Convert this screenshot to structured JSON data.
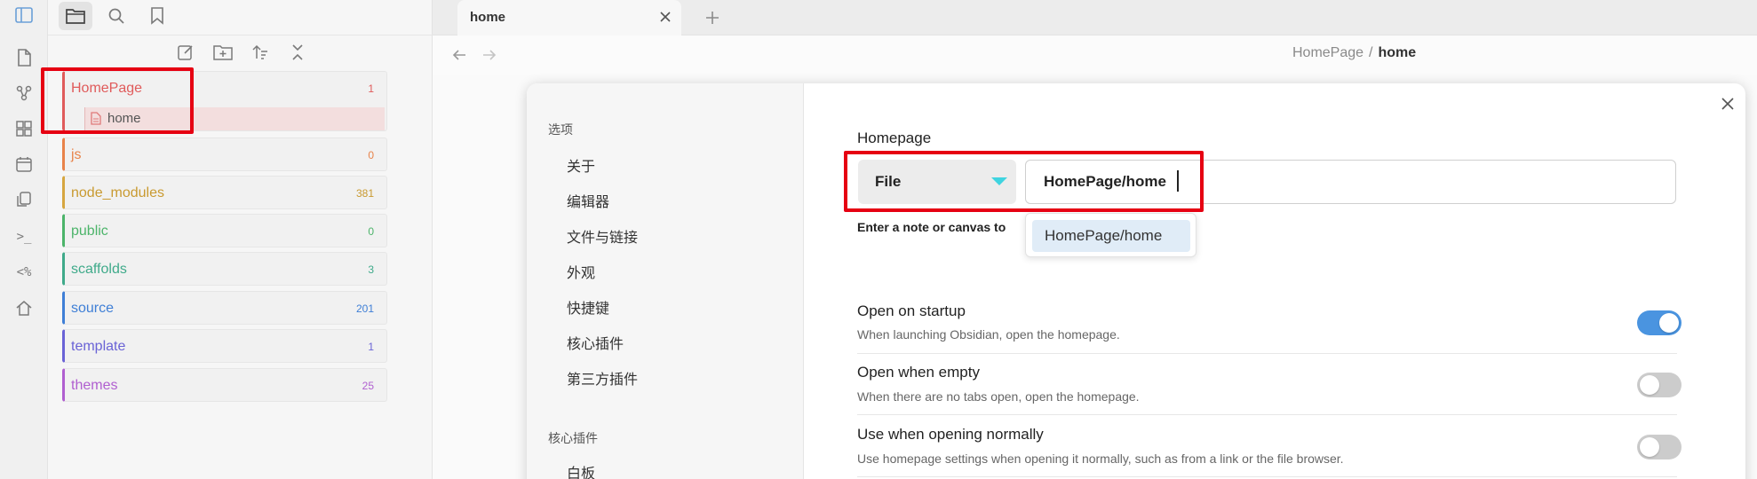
{
  "ribbon": {
    "icons": [
      "sidebar-toggle-icon",
      "new-note-icon",
      "graph-icon",
      "canvas-icon",
      "calendar-icon",
      "templates-icon",
      "terminal-icon",
      "code-icon",
      "home-icon"
    ],
    "terminal_glyph": ">_",
    "code_glyph": "<%"
  },
  "sidebar": {
    "tabs": [
      "files-icon",
      "search-icon",
      "bookmark-icon"
    ],
    "actions": [
      "new-note-icon",
      "new-folder-icon",
      "sort-icon",
      "collapse-icon"
    ],
    "folders": [
      {
        "name": "HomePage",
        "count": "1",
        "color": "#e05b5b",
        "expanded": true,
        "children": [
          {
            "name": "home"
          }
        ]
      },
      {
        "name": "js",
        "count": "0",
        "color": "#e8834a"
      },
      {
        "name": "node_modules",
        "count": "381",
        "color": "#d6a640"
      },
      {
        "name": "public",
        "count": "0",
        "color": "#4cb46a"
      },
      {
        "name": "scaffolds",
        "count": "3",
        "color": "#3faa8a"
      },
      {
        "name": "source",
        "count": "201",
        "color": "#3f7fd6"
      },
      {
        "name": "template",
        "count": "1",
        "color": "#6a63d6"
      },
      {
        "name": "themes",
        "count": "25",
        "color": "#b05fd0"
      }
    ]
  },
  "tabbar": {
    "active_tab": "home",
    "close_glyph": "×",
    "new_tab_glyph": "+"
  },
  "header": {
    "breadcrumb_parent": "HomePage",
    "breadcrumb_sep": "/",
    "breadcrumb_current": "home"
  },
  "modal": {
    "nav": {
      "section1": "选项",
      "items1": [
        "关于",
        "编辑器",
        "文件与链接",
        "外观",
        "快捷键",
        "核心插件",
        "第三方插件"
      ],
      "section2": "核心插件",
      "items2": [
        "白板"
      ]
    },
    "homepage": {
      "label": "Homepage",
      "type_value": "File",
      "path_value": "HomePage/home",
      "hint": "Enter a note or canvas to",
      "suggestion": "HomePage/home"
    },
    "settings": [
      {
        "title": "Open on startup",
        "desc": "When launching Obsidian, open the homepage.",
        "enabled": true
      },
      {
        "title": "Open when empty",
        "desc": "When there are no tabs open, open the homepage.",
        "enabled": false
      },
      {
        "title": "Use when opening normally",
        "desc": "Use homepage settings when opening it normally, such as from a link or the file browser.",
        "enabled": false
      }
    ]
  },
  "colors": {
    "accent": "#4a94e0",
    "annotation": "#e60012",
    "dropdown_arrow": "#3fd4e0"
  }
}
